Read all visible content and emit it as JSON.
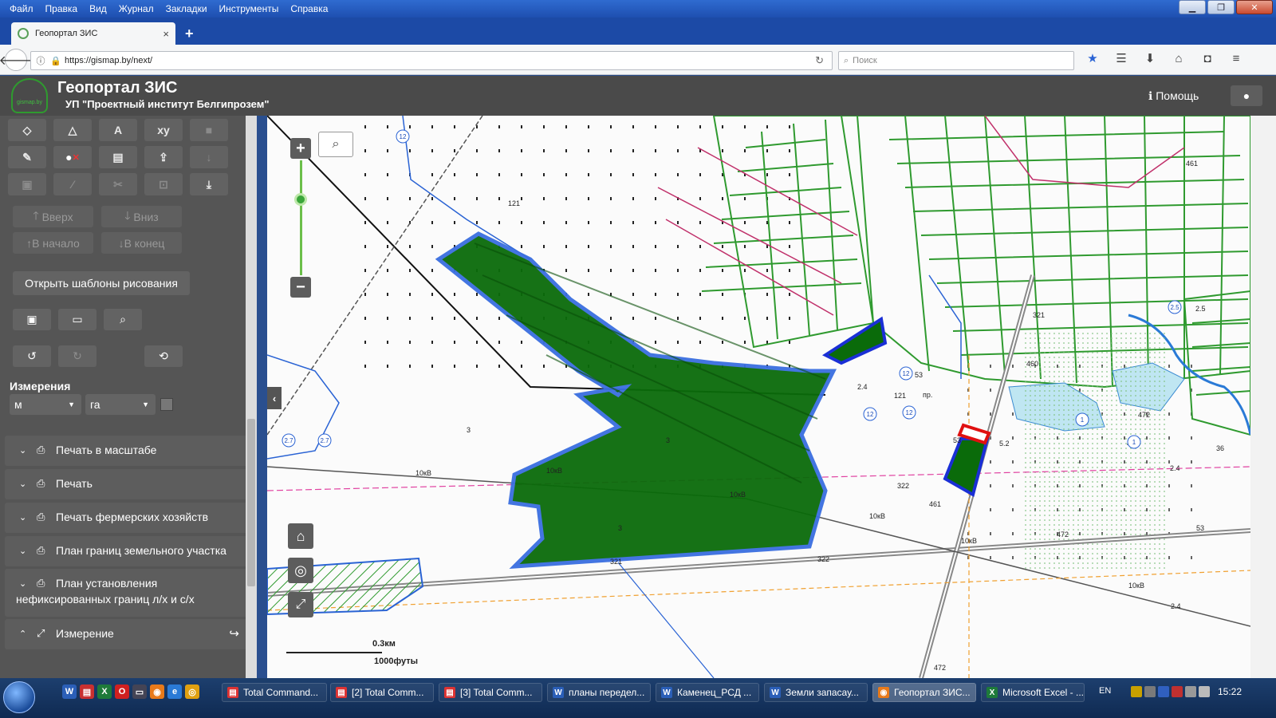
{
  "browser": {
    "menu": [
      "Файл",
      "Правка",
      "Вид",
      "Журнал",
      "Закладки",
      "Инструменты",
      "Справка"
    ],
    "tab_title": "Геопортал ЗИС",
    "tab_close": "×",
    "new_tab": "+",
    "url": "https://gismap.by/next/",
    "search_placeholder": "Поиск"
  },
  "app": {
    "logo_text": "gismap.by",
    "title": "Геопортал ЗИС",
    "subtitle": "УП \"Проектный институт Белгипрозем\"",
    "help": "Помощь"
  },
  "sidebar": {
    "tool_xy": "xy",
    "tool_text": "A",
    "move_up": "Вверх",
    "move_down": "Вниз",
    "move_start": "В начало",
    "move_end": "В конец",
    "open_templates": "Открыть шаблоны рисования",
    "measurements_label": "Измерения",
    "unit_length": "м",
    "unit_area": "га",
    "panels": [
      {
        "label": "Печать в масштабе"
      },
      {
        "label": "Печать"
      },
      {
        "label": "Печать фермерских хозяйств"
      },
      {
        "label": "План границ земельного участка"
      },
      {
        "label": "План установления",
        "label2": "нефиксированных границ л/х и с/х"
      },
      {
        "label": "Измерение"
      }
    ]
  },
  "map": {
    "scale_metric": "0.3км",
    "scale_imperial": "1000футы",
    "scale_small": "3",
    "labels": {
      "kv10": "10кВ",
      "n121": "121",
      "n12": "12",
      "n3": "3",
      "n53": "53",
      "n461": "461",
      "n472": "472",
      "n460": "460",
      "n322": "322",
      "n321": "321",
      "n27": "2.7",
      "n24": "2.4",
      "n25": "2.5",
      "n52": "5.2",
      "n1": "1",
      "n36": "36",
      "pr": "пр."
    },
    "colors": {
      "forest": "#0a6b0a",
      "boundary_blue": "#2255dd",
      "parcel_green": "#2f9a2f",
      "water": "#bfe6f2",
      "red": "#e01010"
    }
  },
  "taskbar": {
    "items": [
      {
        "label": "Total Command..."
      },
      {
        "label": "[2] Total Comm..."
      },
      {
        "label": "[3] Total Comm..."
      },
      {
        "label": "планы передел..."
      },
      {
        "label": "Каменец_РСД ..."
      },
      {
        "label": "Земли запасау..."
      },
      {
        "label": "Геопортал ЗИС..."
      },
      {
        "label": "Microsoft Excel - ..."
      }
    ],
    "lang": "EN",
    "time": "15:22"
  }
}
